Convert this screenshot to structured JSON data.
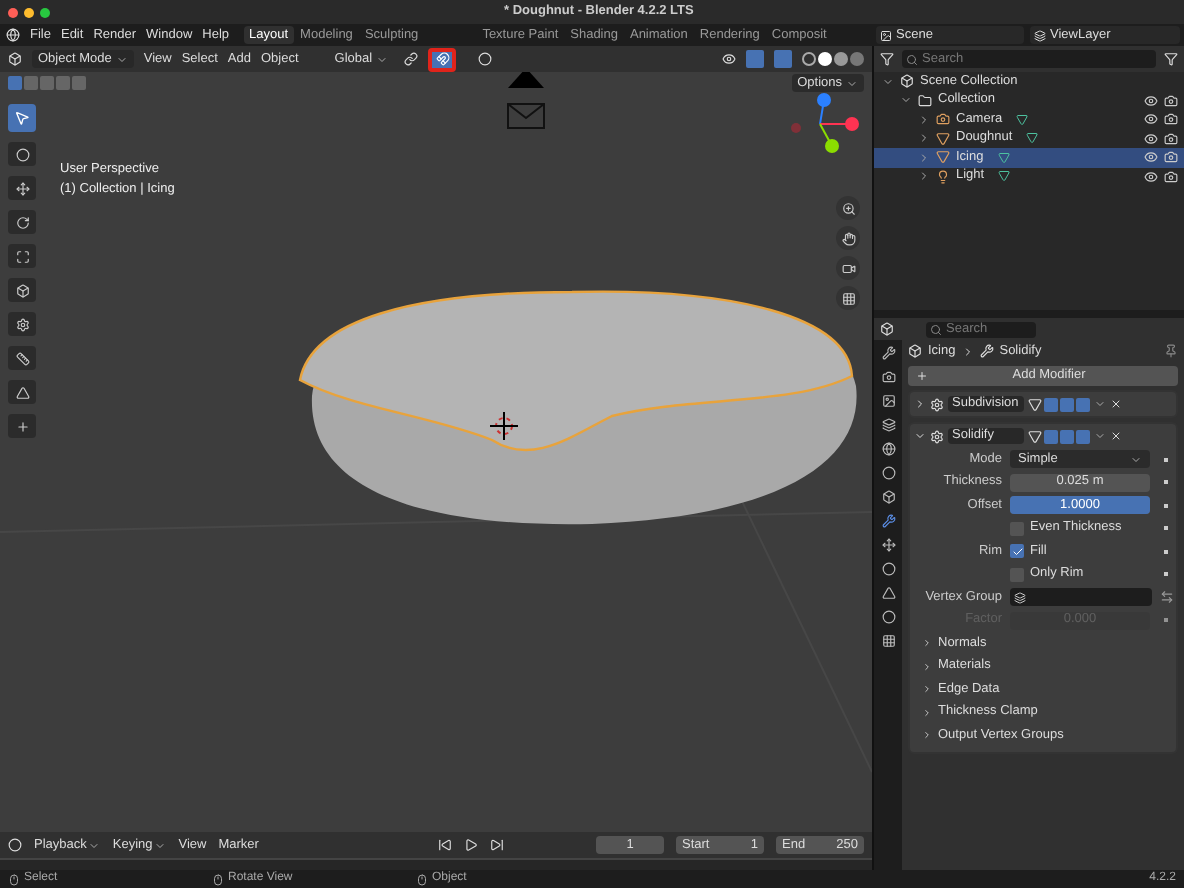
{
  "window": {
    "title": "* Doughnut - Blender 4.2.2 LTS"
  },
  "menu": [
    "File",
    "Edit",
    "Render",
    "Window",
    "Help"
  ],
  "workspaces": [
    {
      "label": "Layout",
      "selected": true
    },
    {
      "label": "Modeling",
      "selected": false
    },
    {
      "label": "Sculpting",
      "selected": false
    },
    {
      "label": "Texture Paint",
      "selected": false
    },
    {
      "label": "Shading",
      "selected": false
    },
    {
      "label": "Animation",
      "selected": false
    },
    {
      "label": "Rendering",
      "selected": false
    },
    {
      "label": "Composit",
      "selected": false
    }
  ],
  "scene": "Scene",
  "view_layer": "ViewLayer",
  "viewport_header": {
    "mode": "Object Mode",
    "menus": [
      "View",
      "Select",
      "Add",
      "Object"
    ],
    "orientation": "Global",
    "snap_on": true,
    "options": "Options"
  },
  "viewport": {
    "perspective": "User Perspective",
    "context": "(1) Collection | Icing"
  },
  "outliner": {
    "search": {
      "placeholder": "Search"
    },
    "tree": [
      {
        "label": "Scene Collection",
        "kind": "scene",
        "selected": false,
        "children": [
          {
            "label": "Collection",
            "kind": "collection",
            "selected": false,
            "children": [
              {
                "label": "Camera",
                "kind": "camera",
                "selected": false
              },
              {
                "label": "Doughnut",
                "kind": "mesh",
                "selected": false
              },
              {
                "label": "Icing",
                "kind": "mesh",
                "selected": true
              },
              {
                "label": "Light",
                "kind": "light",
                "selected": false
              }
            ]
          }
        ]
      }
    ]
  },
  "properties": {
    "search": {
      "placeholder": "Search"
    },
    "object": "Icing",
    "modifier": "Solidify",
    "add_modifier": "Add Modifier",
    "modifiers": [
      {
        "name": "Subdivision",
        "expanded": false
      },
      {
        "name": "Solidify",
        "expanded": true
      }
    ],
    "fields": [
      {
        "kind": "dropdown",
        "label": "Mode",
        "value": "Simple",
        "disabled": false
      },
      {
        "kind": "number",
        "label": "Thickness",
        "value": "0.025 m",
        "disabled": false
      },
      {
        "kind": "slider",
        "label": "Offset",
        "value": "1.0000",
        "level": 1,
        "disabled": false
      },
      {
        "kind": "checkbox",
        "text": "Even Thickness",
        "checked": false,
        "disabled": false
      },
      {
        "kind": "checkbox",
        "label": "Rim",
        "text": "Fill",
        "checked": true,
        "disabled": false
      },
      {
        "kind": "checkbox",
        "text": "Only Rim",
        "checked": false,
        "disabled": false
      },
      {
        "kind": "field",
        "label": "Vertex Group",
        "disabled": false
      },
      {
        "kind": "number",
        "label": "Factor",
        "value": "0.000",
        "disabled": true
      }
    ],
    "subpanels": [
      {
        "label": "Normals",
        "expanded": false
      },
      {
        "label": "Materials",
        "expanded": false
      },
      {
        "label": "Edge Data",
        "expanded": false
      },
      {
        "label": "Thickness Clamp",
        "expanded": false
      },
      {
        "label": "Output Vertex Groups",
        "expanded": false
      }
    ]
  },
  "timeline": {
    "menus": [
      "Playback",
      "Keying",
      "View",
      "Marker"
    ],
    "frame": "1",
    "start_label": "Start",
    "start": "1",
    "end_label": "End",
    "end": "250"
  },
  "status_bar": {
    "items": [
      "Select",
      "Rotate View",
      "Object"
    ],
    "version": "4.2.2"
  }
}
